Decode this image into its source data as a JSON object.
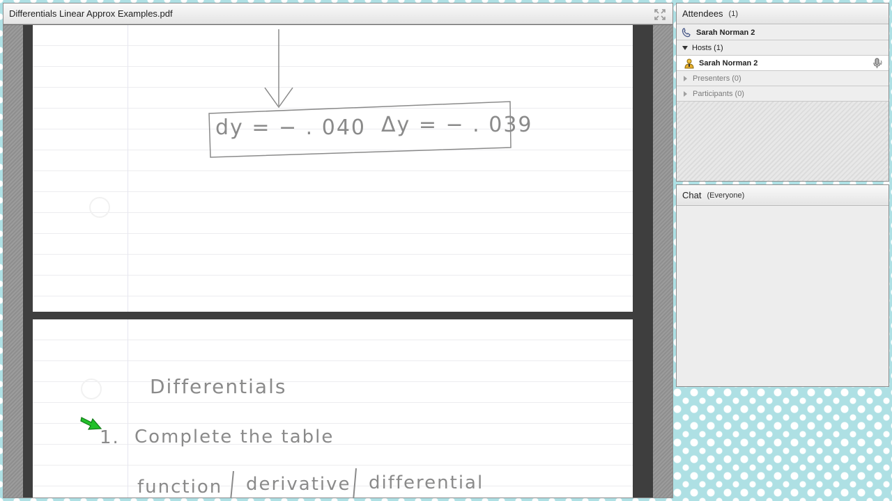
{
  "share_pod": {
    "title": "Differentials Linear Approx Examples.pdf",
    "page1": {
      "box_left": "dy = − . 040",
      "box_right": "Δy = − . 039"
    },
    "page2": {
      "heading": "Differentials",
      "item_number": "1.",
      "item_text": "Complete the table",
      "col_function": "function",
      "col_derivative": "derivative",
      "col_differential": "differential"
    }
  },
  "attendees": {
    "title": "Attendees",
    "count": "(1)",
    "current_user": "Sarah Norman 2",
    "hosts_label": "Hosts (1)",
    "host_name": "Sarah Norman 2",
    "presenters_label": "Presenters (0)",
    "participants_label": "Participants (0)"
  },
  "chat": {
    "title": "Chat",
    "scope": "(Everyone)"
  },
  "colors": {
    "pointer_arrow": "#22c02a",
    "background_pattern": "#aee0e4"
  }
}
